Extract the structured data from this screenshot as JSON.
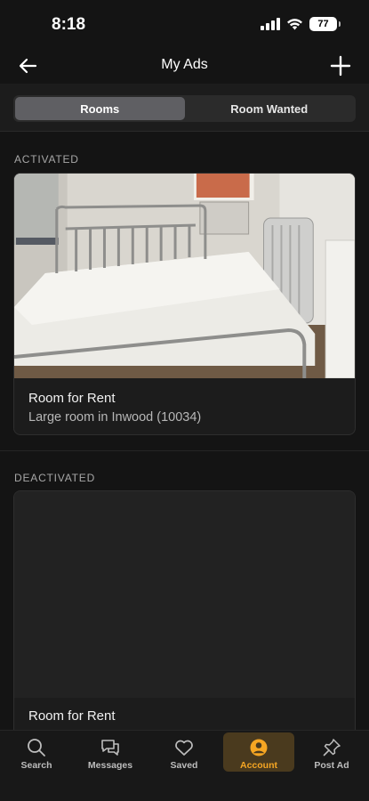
{
  "status": {
    "time": "8:18",
    "battery": "77"
  },
  "nav": {
    "title": "My Ads"
  },
  "segments": {
    "rooms": "Rooms",
    "room_wanted": "Room Wanted",
    "selected": "Rooms"
  },
  "sections": {
    "activated": {
      "label": "ACTIVATED",
      "card": {
        "title": "Room for Rent",
        "subtitle": "Large room in Inwood (10034)"
      }
    },
    "deactivated": {
      "label": "DEACTIVATED",
      "card": {
        "title": "Room for Rent"
      }
    }
  },
  "tabs": [
    {
      "label": "Search",
      "icon": "search-icon"
    },
    {
      "label": "Messages",
      "icon": "messages-icon"
    },
    {
      "label": "Saved",
      "icon": "heart-icon"
    },
    {
      "label": "Account",
      "icon": "account-icon",
      "active": true
    },
    {
      "label": "Post Ad",
      "icon": "pin-icon"
    }
  ],
  "colors": {
    "accent": "#f6a623",
    "background": "#141414",
    "card": "#1c1c1c"
  }
}
